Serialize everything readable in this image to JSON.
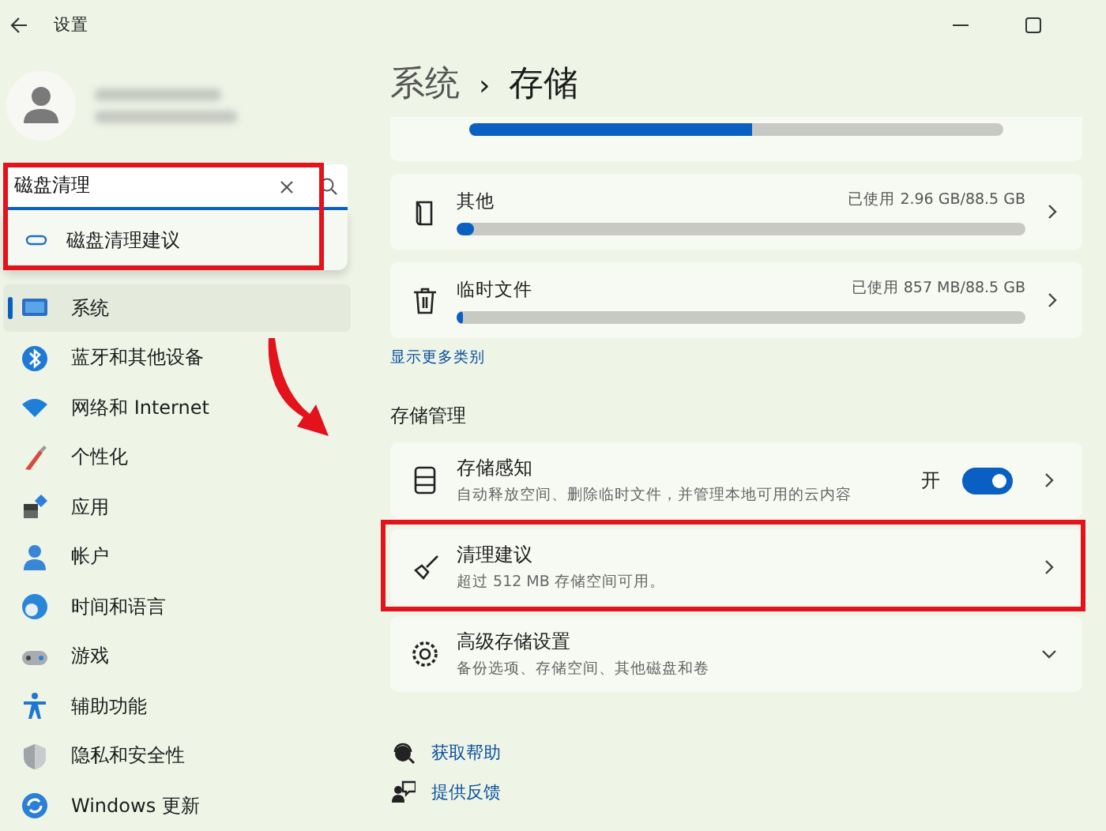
{
  "window": {
    "title": "设置"
  },
  "search": {
    "value": "磁盘清理",
    "highlighted": true,
    "suggestions": [
      "磁盘清理建议"
    ]
  },
  "nav": {
    "items": [
      {
        "label": "系统",
        "selected": true
      },
      {
        "label": "蓝牙和其他设备",
        "selected": false
      },
      {
        "label": "网络和 Internet",
        "selected": false
      },
      {
        "label": "个性化",
        "selected": false
      },
      {
        "label": "应用",
        "selected": false
      },
      {
        "label": "帐户",
        "selected": false
      },
      {
        "label": "时间和语言",
        "selected": false
      },
      {
        "label": "游戏",
        "selected": false
      },
      {
        "label": "辅助功能",
        "selected": false
      },
      {
        "label": "隐私和安全性",
        "selected": false
      },
      {
        "label": "Windows 更新",
        "selected": false
      }
    ]
  },
  "breadcrumb": {
    "parent": "系统",
    "separator": "›",
    "current": "存储"
  },
  "partial_bar": {
    "level": 0.53
  },
  "storage_items": [
    {
      "label": "其他",
      "usage": "已使用 2.96 GB/88.5 GB",
      "level": 0.03
    },
    {
      "label": "临时文件",
      "usage": "已使用 857 MB/88.5 GB",
      "level": 0.012
    }
  ],
  "show_more": "显示更多类别",
  "storage_management": {
    "title": "存储管理",
    "items": [
      {
        "kind": "toggle",
        "title": "存储感知",
        "subtitle": "自动释放空间、删除临时文件，并管理本地可用的云内容",
        "state_label": "开",
        "on": true,
        "highlighted": false
      },
      {
        "kind": "link",
        "title": "清理建议",
        "subtitle": "超过 512 MB 存储空间可用。",
        "highlighted": true
      },
      {
        "kind": "expander",
        "title": "高级存储设置",
        "subtitle": "备份选项、存储空间、其他磁盘和卷",
        "expanded": false,
        "highlighted": false
      }
    ]
  },
  "help_links": [
    "获取帮助",
    "提供反馈"
  ]
}
